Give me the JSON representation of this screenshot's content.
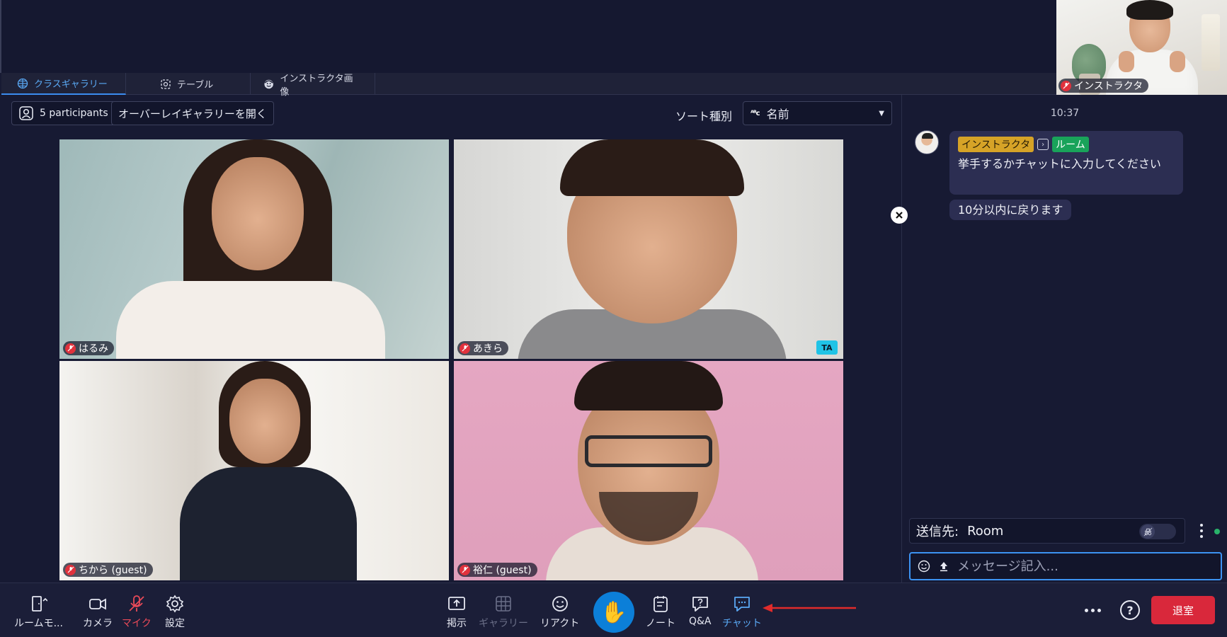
{
  "instructor_view": {
    "name": "インストラクタ"
  },
  "tabs": [
    {
      "label": "クラスギャラリー",
      "icon": "grid-icon",
      "active": true
    },
    {
      "label": "テーブル",
      "icon": "table-icon",
      "active": false
    },
    {
      "label": "インストラクタ画像",
      "icon": "instructor-icon",
      "active": false
    }
  ],
  "gallery": {
    "participants_label": "5 participants",
    "overlay_button": "オーバーレイギャラリーを開く",
    "sort_label": "ソート種別",
    "sort_value": "名前",
    "tiles": [
      {
        "name": "はるみ",
        "muted": true
      },
      {
        "name": "あきら",
        "muted": true,
        "badge": "TA"
      },
      {
        "name": "ちから (guest)",
        "muted": true
      },
      {
        "name": "裕仁 (guest)",
        "muted": true
      }
    ]
  },
  "chat": {
    "time": "10:37",
    "sender_tag": "インストラクタ",
    "recipient_tag": "ルーム",
    "messages": [
      "挙手するかチャットに入力してください",
      "10分以内に戻ります"
    ],
    "recipient_label": "送信先:",
    "recipient_value": "Room",
    "input_placeholder": "メッセージ記入..."
  },
  "toolbar": {
    "room_mode": "ルームモ...",
    "camera": "カメラ",
    "mic": "マイク",
    "settings": "設定",
    "post": "掲示",
    "gallery": "ギャラリー",
    "react": "リアクト",
    "notes": "ノート",
    "qa": "Q&A",
    "chat": "チャット",
    "leave": "退室"
  },
  "colors": {
    "accent": "#3b8cf0",
    "leave": "#d9283b",
    "instructor_tag": "#d6a327",
    "room_tag": "#19a35a"
  }
}
